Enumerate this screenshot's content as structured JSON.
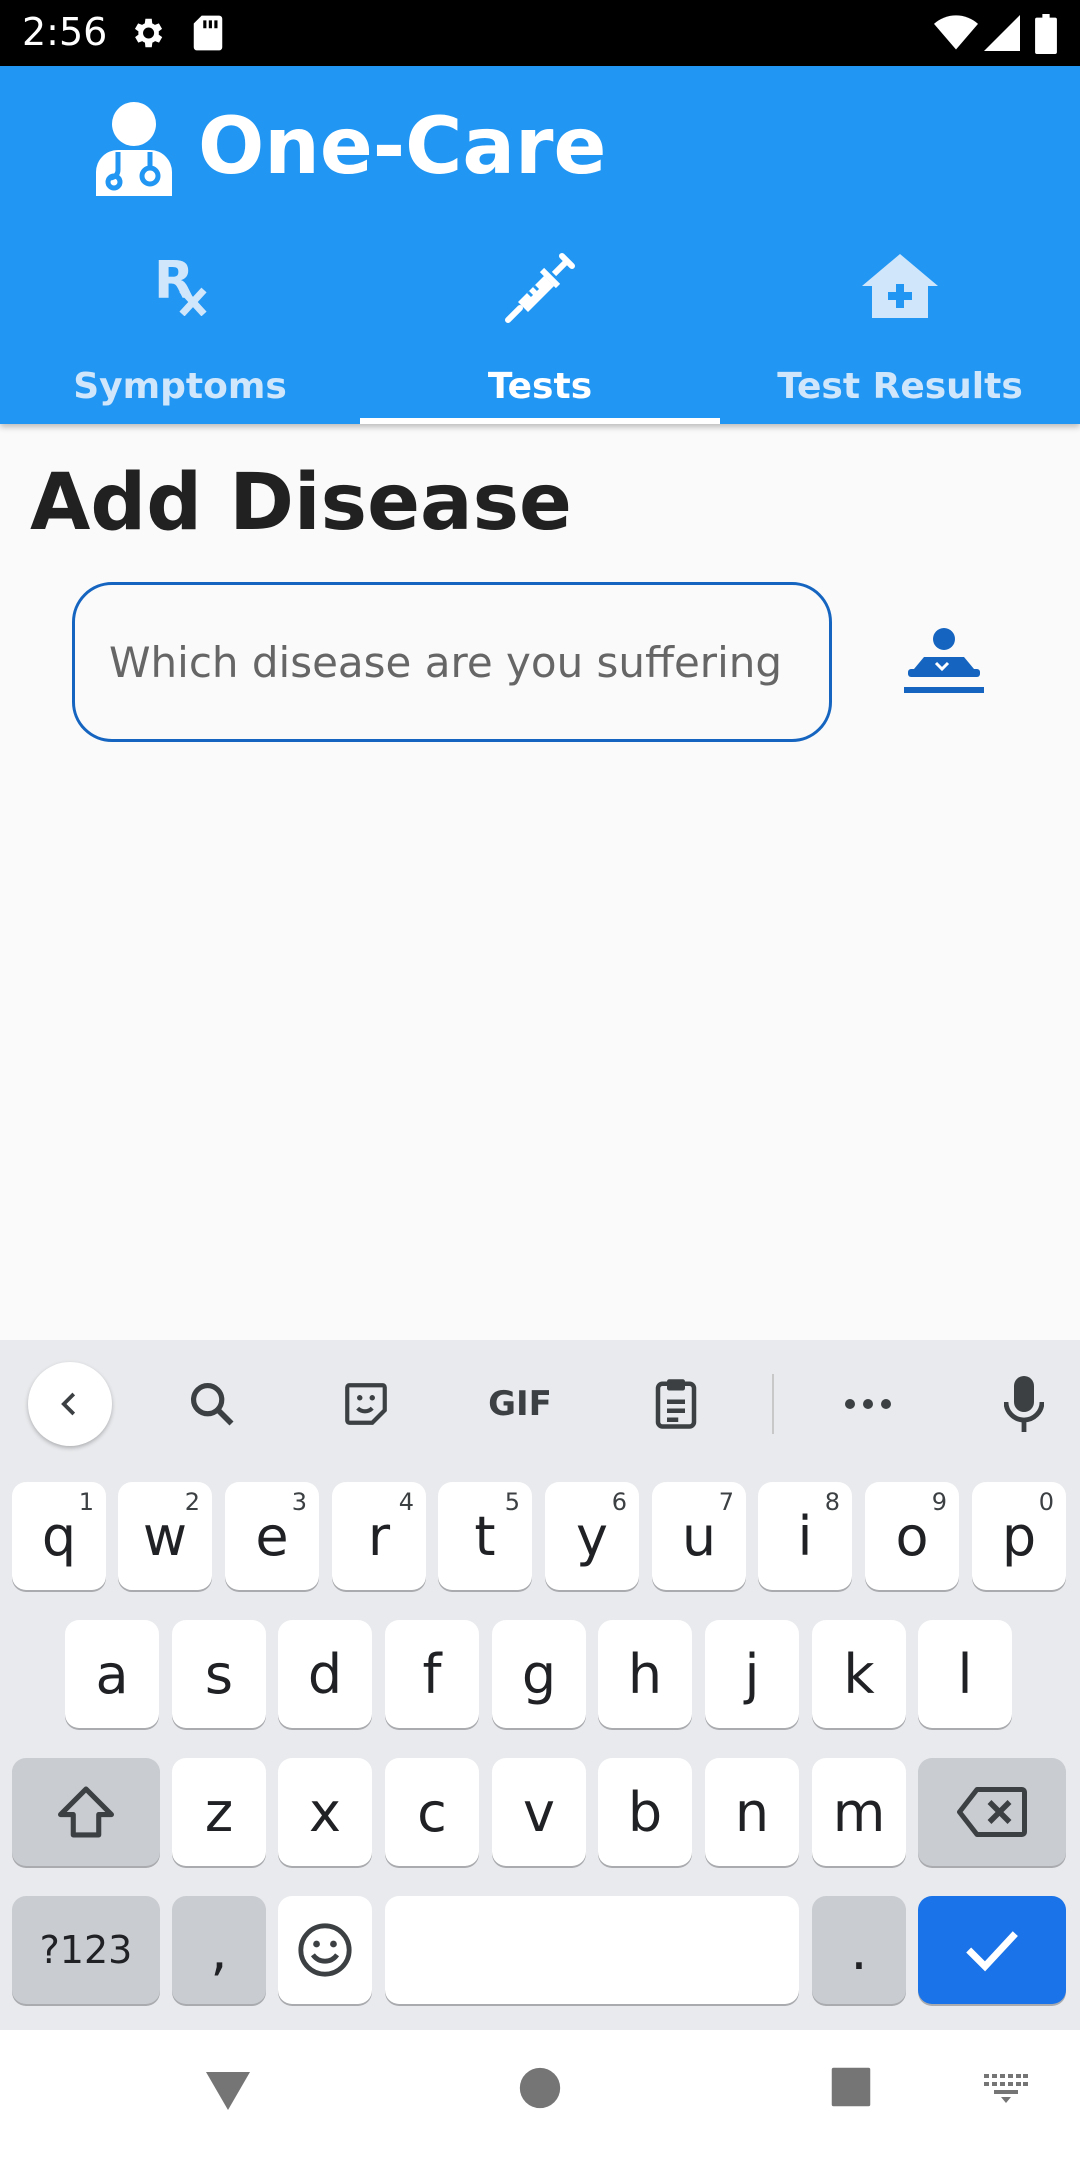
{
  "status_bar": {
    "time": "2:56",
    "icons": [
      "settings-icon",
      "sd-card-icon",
      "wifi-icon",
      "signal-icon",
      "battery-icon"
    ]
  },
  "app": {
    "title": "One-Care",
    "logo_icon": "doctor-icon",
    "brand_color": "#2196f3"
  },
  "tabs": [
    {
      "label": "Symptoms",
      "icon": "prescription-icon",
      "active": false
    },
    {
      "label": "Tests",
      "icon": "syringe-icon",
      "active": true
    },
    {
      "label": "Test Results",
      "icon": "clinic-icon",
      "active": false
    }
  ],
  "page": {
    "title": "Add Disease",
    "input_value": "",
    "input_placeholder": "Which disease are you suffering …",
    "add_button_icon": "patient-bed-icon",
    "accent_color": "#1565c0"
  },
  "keyboard": {
    "toolbar": [
      "back-icon",
      "search-icon",
      "sticker-icon",
      "GIF",
      "clipboard-icon",
      "more-icon",
      "microphone-icon"
    ],
    "gif_label": "GIF",
    "row1": [
      "q",
      "w",
      "e",
      "r",
      "t",
      "y",
      "u",
      "i",
      "o",
      "p"
    ],
    "row1_hints": [
      "1",
      "2",
      "3",
      "4",
      "5",
      "6",
      "7",
      "8",
      "9",
      "0"
    ],
    "row2": [
      "a",
      "s",
      "d",
      "f",
      "g",
      "h",
      "j",
      "k",
      "l"
    ],
    "row3": [
      "z",
      "x",
      "c",
      "v",
      "b",
      "n",
      "m"
    ],
    "symbols_label": "?123",
    "comma_label": ",",
    "period_label": ".",
    "action_color": "#1a73e8"
  },
  "nav_bar": {
    "icons": [
      "back-triangle-icon",
      "home-circle-icon",
      "recents-square-icon",
      "keyboard-switch-icon"
    ]
  }
}
